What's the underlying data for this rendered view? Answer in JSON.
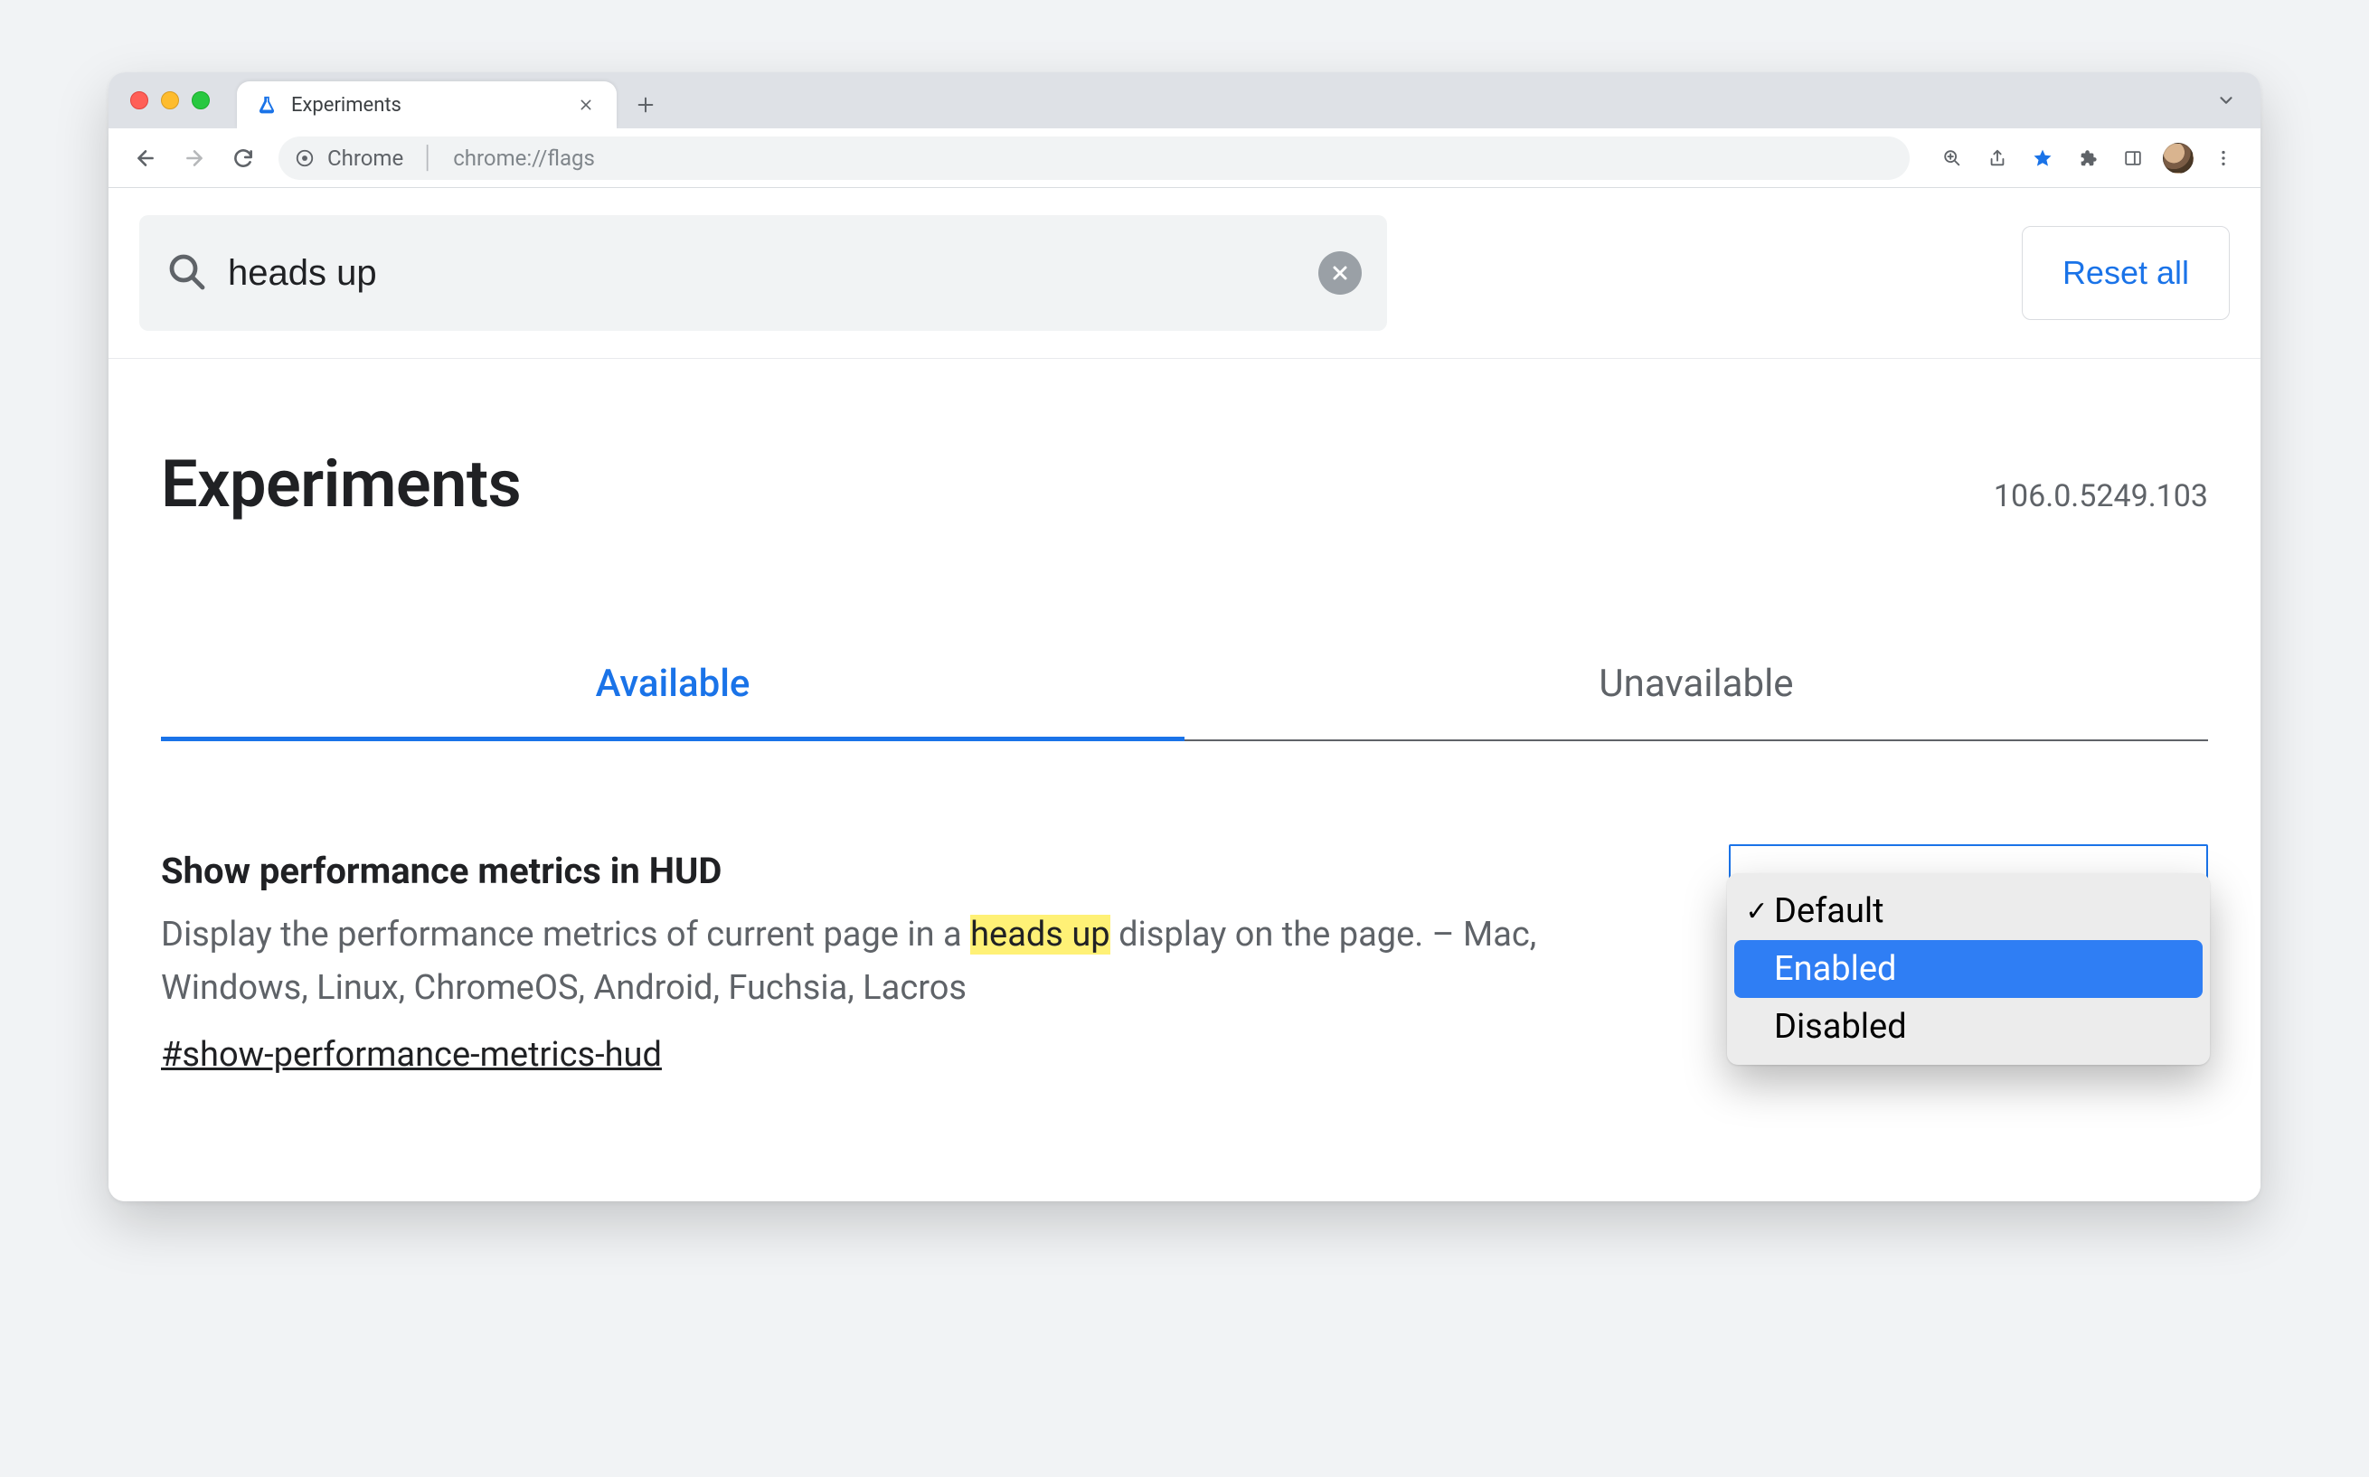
{
  "browser": {
    "tab_title": "Experiments",
    "address_origin": "Chrome",
    "address_path": "chrome://flags"
  },
  "search": {
    "query": "heads up"
  },
  "actions": {
    "reset_all": "Reset all"
  },
  "page_title": "Experiments",
  "version": "106.0.5249.103",
  "tabs": {
    "available": "Available",
    "unavailable": "Unavailable"
  },
  "flag": {
    "title": "Show performance metrics in HUD",
    "desc_before": "Display the performance metrics of current page in a ",
    "desc_highlight": "heads up",
    "desc_after": " display on the page. – Mac, Windows, Linux, ChromeOS, Android, Fuchsia, Lacros",
    "anchor": "#show-performance-metrics-hud"
  },
  "dropdown": {
    "options": [
      "Default",
      "Enabled",
      "Disabled"
    ],
    "selected": "Default",
    "highlighted": "Enabled"
  }
}
